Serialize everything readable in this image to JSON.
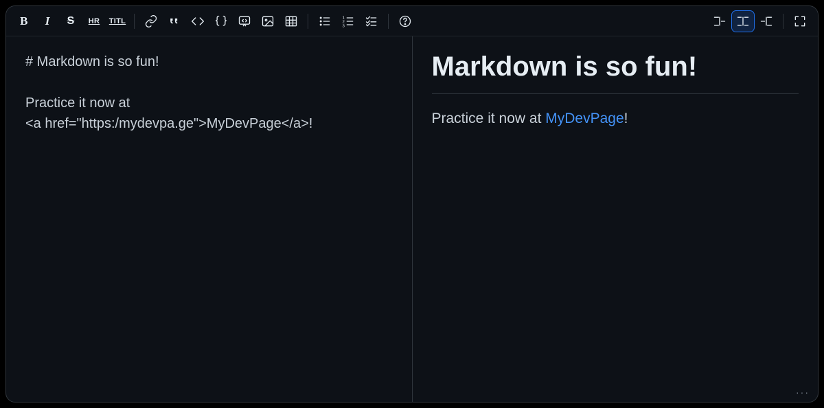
{
  "toolbar": {
    "bold": "B",
    "hr": "HR",
    "title": "TITL"
  },
  "editor": {
    "raw": "# Markdown is so fun!\n\nPractice it now at\n<a href=\"https:/mydevpa.ge\">MyDevPage</a>!"
  },
  "preview": {
    "heading": "Markdown is so fun!",
    "para_before": "Practice it now at ",
    "link_text": "MyDevPage",
    "para_after": "!"
  },
  "view_mode": "split",
  "corner_more": "···"
}
